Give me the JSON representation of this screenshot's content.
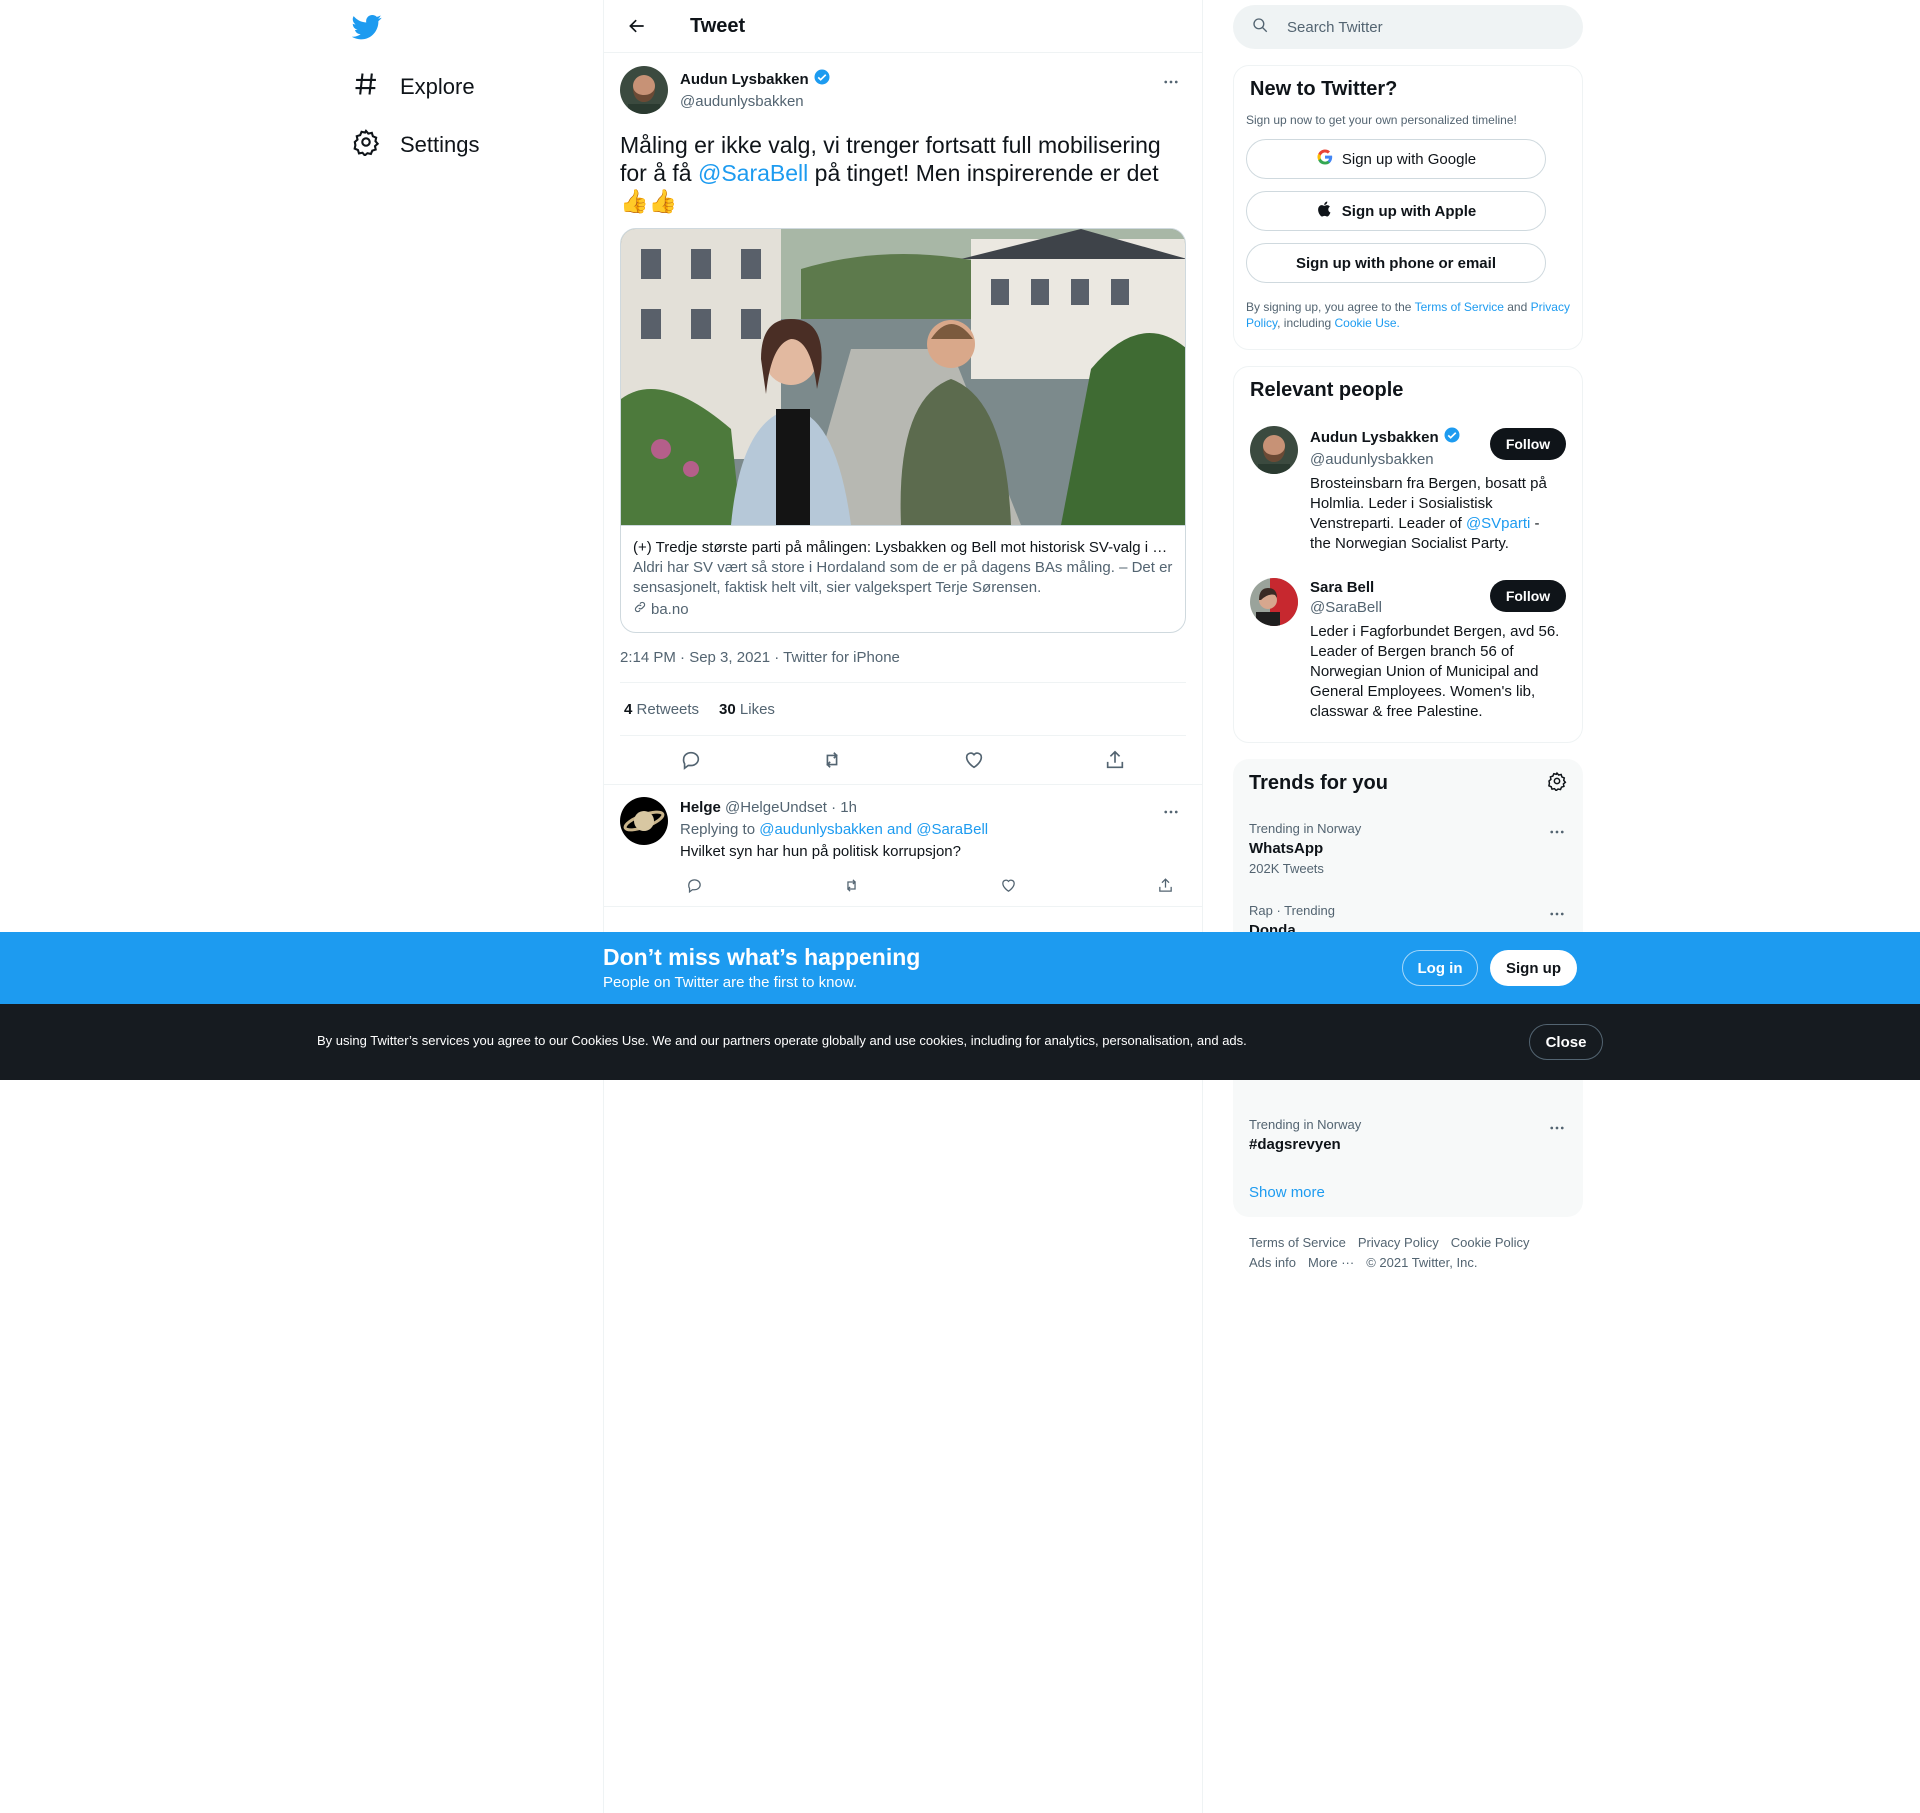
{
  "nav": {
    "items": [
      {
        "label": "Explore",
        "icon": "hashtag-icon"
      },
      {
        "label": "Settings",
        "icon": "gear-icon"
      }
    ]
  },
  "header": {
    "title": "Tweet"
  },
  "tweet": {
    "author_name": "Audun Lysbakken",
    "author_handle": "@audunlysbakken",
    "text_before": "Måling er ikke valg, vi trenger fortsatt full mobilisering for å få ",
    "mention": "@SaraBell",
    "text_after": " på tinget! Men inspirerende er det ",
    "emoji": "👍👍",
    "card": {
      "title": "(+) Tredje største parti på målingen: Lysbakken og Bell mot historisk SV-valg i Hordaland",
      "description": "Aldri har SV vært så store i Hordaland som de er på dagens BAs måling. – Det er sensasjonelt, faktisk helt vilt, sier valgekspert Terje Sørensen.",
      "domain": "ba.no"
    },
    "meta": "2:14 PM · Sep 3, 2021 · Twitter for iPhone",
    "retweets_count": "4",
    "retweets_label": "Retweets",
    "likes_count": "30",
    "likes_label": "Likes"
  },
  "reply": {
    "name": "Helge",
    "handle_time": "@HelgeUndset · 1h",
    "replying_prefix": "Replying to ",
    "replying_to": "@audunlysbakken and @SaraBell",
    "text": "Hvilket syn har hun på politisk korrupsjon?"
  },
  "search": {
    "placeholder": "Search Twitter"
  },
  "signup_panel": {
    "title": "New to Twitter?",
    "subtitle": "Sign up now to get your own personalized timeline!",
    "google": "Sign up with Google",
    "apple": "Sign up with Apple",
    "phone": "Sign up with phone or email",
    "legal_1": "By signing up, you agree to the ",
    "tos": "Terms of Service",
    "legal_2": " and ",
    "privacy": "Privacy Policy",
    "legal_3": ", including ",
    "cookie": "Cookie Use."
  },
  "relevant": {
    "title": "Relevant people",
    "people": [
      {
        "name": "Audun Lysbakken",
        "handle": "@audunlysbakken",
        "bio_before": "Brosteinsbarn fra Bergen, bosatt på Holmlia. Leder i Sosialistisk Venstreparti. Leader of ",
        "bio_mention": "@SVparti",
        "bio_after": " - the Norwegian Socialist Party.",
        "follow": "Follow"
      },
      {
        "name": "Sara Bell",
        "handle": "@SaraBell",
        "bio": "Leder i Fagforbundet Bergen, avd 56. Leader of Bergen branch 56 of Norwegian Union of Municipal and General Employees. Women's lib, classwar & free Palestine.",
        "follow": "Follow"
      }
    ]
  },
  "trends": {
    "title": "Trends for you",
    "items": [
      {
        "context": "Trending in Norway",
        "name": "WhatsApp",
        "count": "202K Tweets"
      },
      {
        "context": "Rap · Trending",
        "name": "Donda",
        "count": ""
      },
      {
        "context": "Trending in Norway",
        "name": "#dagsrevyen",
        "count": ""
      }
    ],
    "show_more": "Show more"
  },
  "footer": {
    "links": [
      "Terms of Service",
      "Privacy Policy",
      "Cookie Policy",
      "Ads info",
      "More ···",
      "© 2021 Twitter, Inc."
    ]
  },
  "banner": {
    "title": "Don’t miss what’s happening",
    "subtitle": "People on Twitter are the first to know.",
    "login": "Log in",
    "signup": "Sign up"
  },
  "cookie_bar": {
    "text": "By using Twitter’s services you agree to our Cookies Use. We and our partners operate globally and use cookies, including for analytics, personalisation, and ads.",
    "close": "Close"
  },
  "colors": {
    "accent": "#1d9bf0",
    "text": "#0f1419",
    "secondary": "#536471",
    "cookie_bg": "#161b20"
  }
}
